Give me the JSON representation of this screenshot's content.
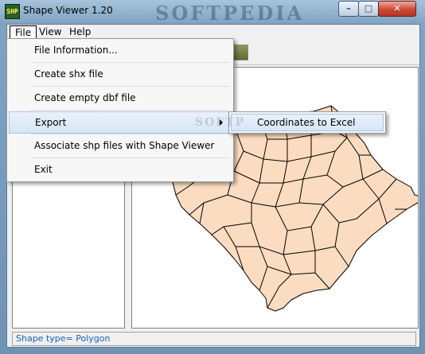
{
  "window": {
    "title": "Shape Viewer 1.20",
    "icon_text": "SHP",
    "watermark": "SOFTPEDIA",
    "controls": {
      "minimize": "–",
      "maximize": "□",
      "close": "✕"
    }
  },
  "menubar": [
    {
      "label": "File",
      "active": true
    },
    {
      "label": "View",
      "active": false
    },
    {
      "label": "Help",
      "active": false
    }
  ],
  "file_menu": {
    "items": [
      {
        "label": "File Information..."
      },
      {
        "label": "Create shx file"
      },
      {
        "label": "Create empty dbf file"
      },
      {
        "label": "Export",
        "has_submenu": true,
        "highlighted": true
      },
      {
        "label": "Associate shp files with Shape Viewer"
      },
      {
        "label": "Exit"
      }
    ]
  },
  "export_submenu": {
    "items": [
      {
        "label": "Coordinates to Excel"
      }
    ]
  },
  "submenu_watermark": "SOFTP",
  "statusbar": {
    "text": "Shape type= Polygon"
  },
  "map": {
    "fill": "#fcdcc0",
    "stroke": "#000000"
  }
}
